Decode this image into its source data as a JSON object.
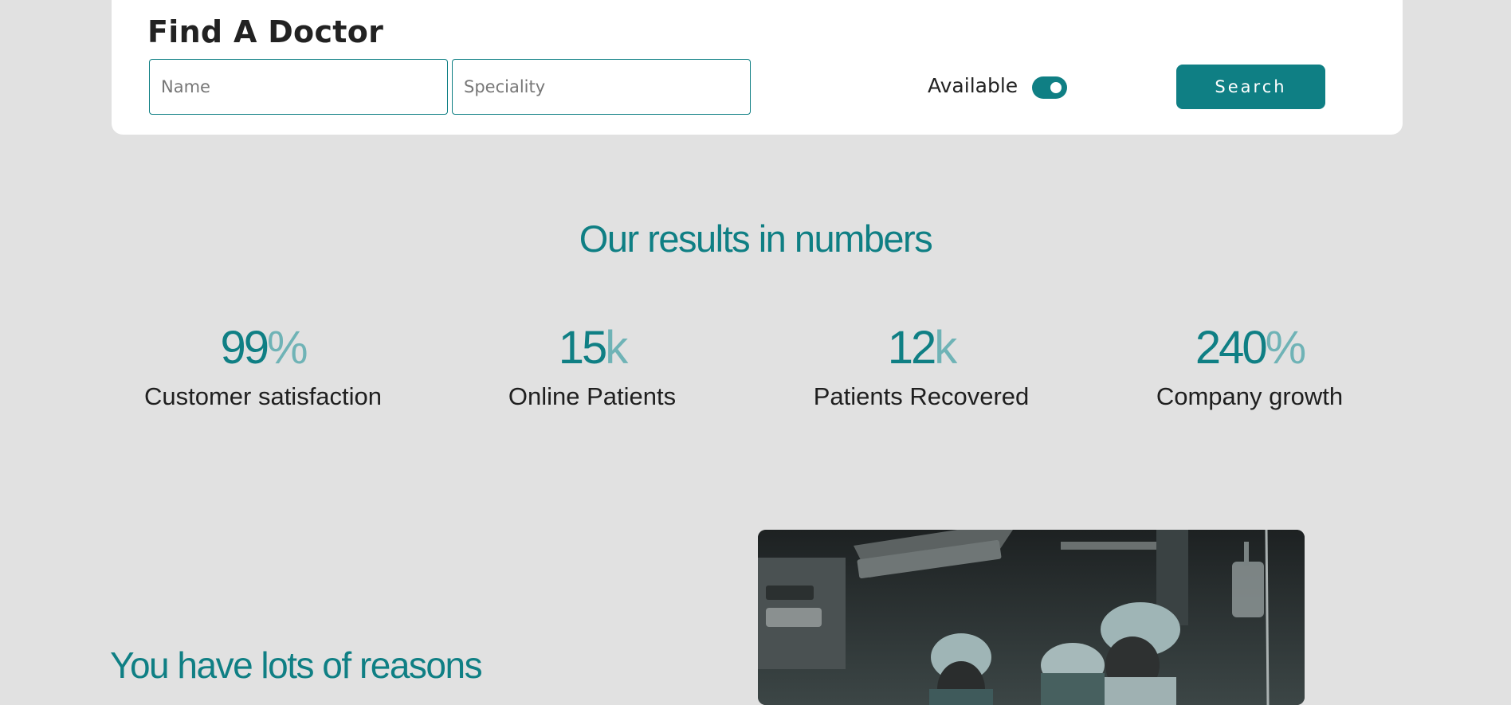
{
  "search": {
    "title": "Find A Doctor",
    "name_placeholder": "Name",
    "speciality_placeholder": "Speciality",
    "available_label": "Available",
    "available_on": true,
    "button_label": "Search"
  },
  "results": {
    "heading": "Our results in numbers",
    "stats": [
      {
        "value": "99",
        "suffix": "%",
        "label": "Customer satisfaction"
      },
      {
        "value": "15",
        "suffix": "k",
        "label": "Online Patients"
      },
      {
        "value": "12",
        "suffix": "k",
        "label": "Patients Recovered"
      },
      {
        "value": "240",
        "suffix": "%",
        "label": "Company growth"
      }
    ]
  },
  "reasons": {
    "heading": "You have lots of reasons"
  },
  "colors": {
    "accent": "#0f7f84",
    "accent_light": "#6fb3b6",
    "page_bg": "#e1e1e1",
    "card_bg": "#ffffff"
  }
}
